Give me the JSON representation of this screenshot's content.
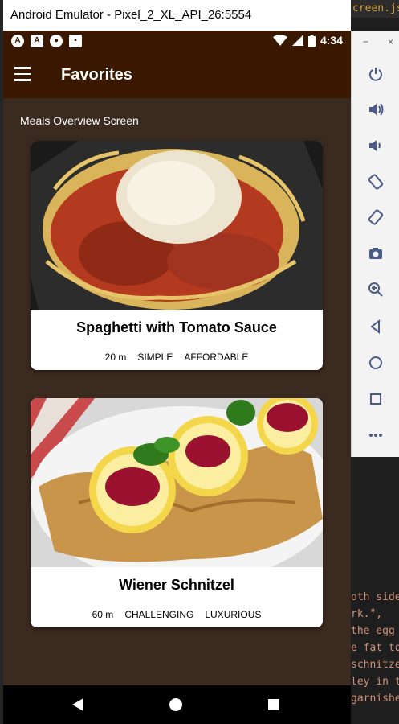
{
  "emulator": {
    "title": "Android Emulator - Pixel_2_XL_API_26:5554",
    "side_panel": {
      "minimize_glyph": "−",
      "close_glyph": "×",
      "buttons": [
        "power-icon",
        "volume-up-icon",
        "volume-down-icon",
        "rotate-left-icon",
        "rotate-right-icon",
        "camera-icon",
        "zoom-icon",
        "back-icon",
        "home-icon",
        "overview-icon",
        "more-icon"
      ]
    }
  },
  "status_bar": {
    "time": "4:34",
    "left_icons": [
      "A",
      "A",
      "●",
      "▪"
    ]
  },
  "app_bar": {
    "title": "Favorites"
  },
  "screen": {
    "label": "Meals Overview Screen"
  },
  "meals": [
    {
      "title": "Spaghetti with Tomato Sauce",
      "duration": "20 m",
      "complexity": "SIMPLE",
      "affordability": "AFFORDABLE"
    },
    {
      "title": "Wiener Schnitzel",
      "duration": "60 m",
      "complexity": "CHALLENGING",
      "affordability": "LUXURIOUS"
    }
  ],
  "editor": {
    "tab_label": "creen.js",
    "code_lines": [
      "",
      "oth side",
      "rk.\",",
      "the egg",
      "e fat to",
      "schnitze",
      "ley in t",
      "garnishe"
    ]
  },
  "colors": {
    "app_bar": "#3a1800",
    "content_bg": "#3b2a1f",
    "card_bg": "#ffffff"
  }
}
